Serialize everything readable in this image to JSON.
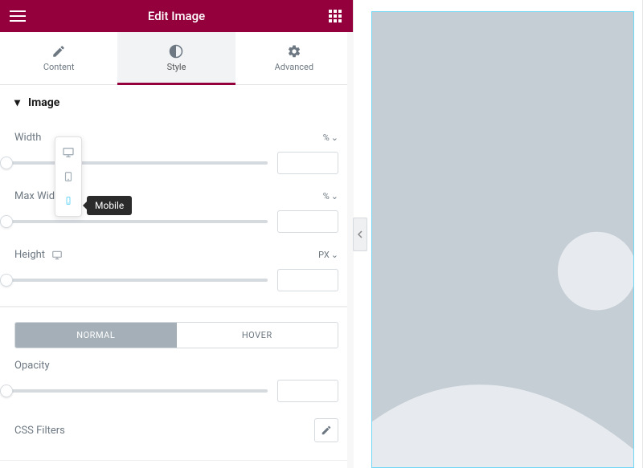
{
  "header": {
    "title": "Edit Image"
  },
  "tabs": {
    "content": "Content",
    "style": "Style",
    "advanced": "Advanced",
    "active": "style"
  },
  "section_image": {
    "title": "Image"
  },
  "controls": {
    "width": {
      "label": "Width",
      "unit": "%",
      "value": ""
    },
    "max_width": {
      "label": "Max Width",
      "unit": "%",
      "value": ""
    },
    "height": {
      "label": "Height",
      "unit": "PX",
      "value": ""
    },
    "opacity": {
      "label": "Opacity",
      "value": ""
    },
    "css_filters": {
      "label": "CSS Filters"
    }
  },
  "state_tabs": {
    "normal": "NORMAL",
    "hover": "HOVER",
    "active": "normal"
  },
  "device_popover": {
    "options": [
      "desktop",
      "tablet",
      "mobile"
    ],
    "tooltip": "Mobile"
  }
}
